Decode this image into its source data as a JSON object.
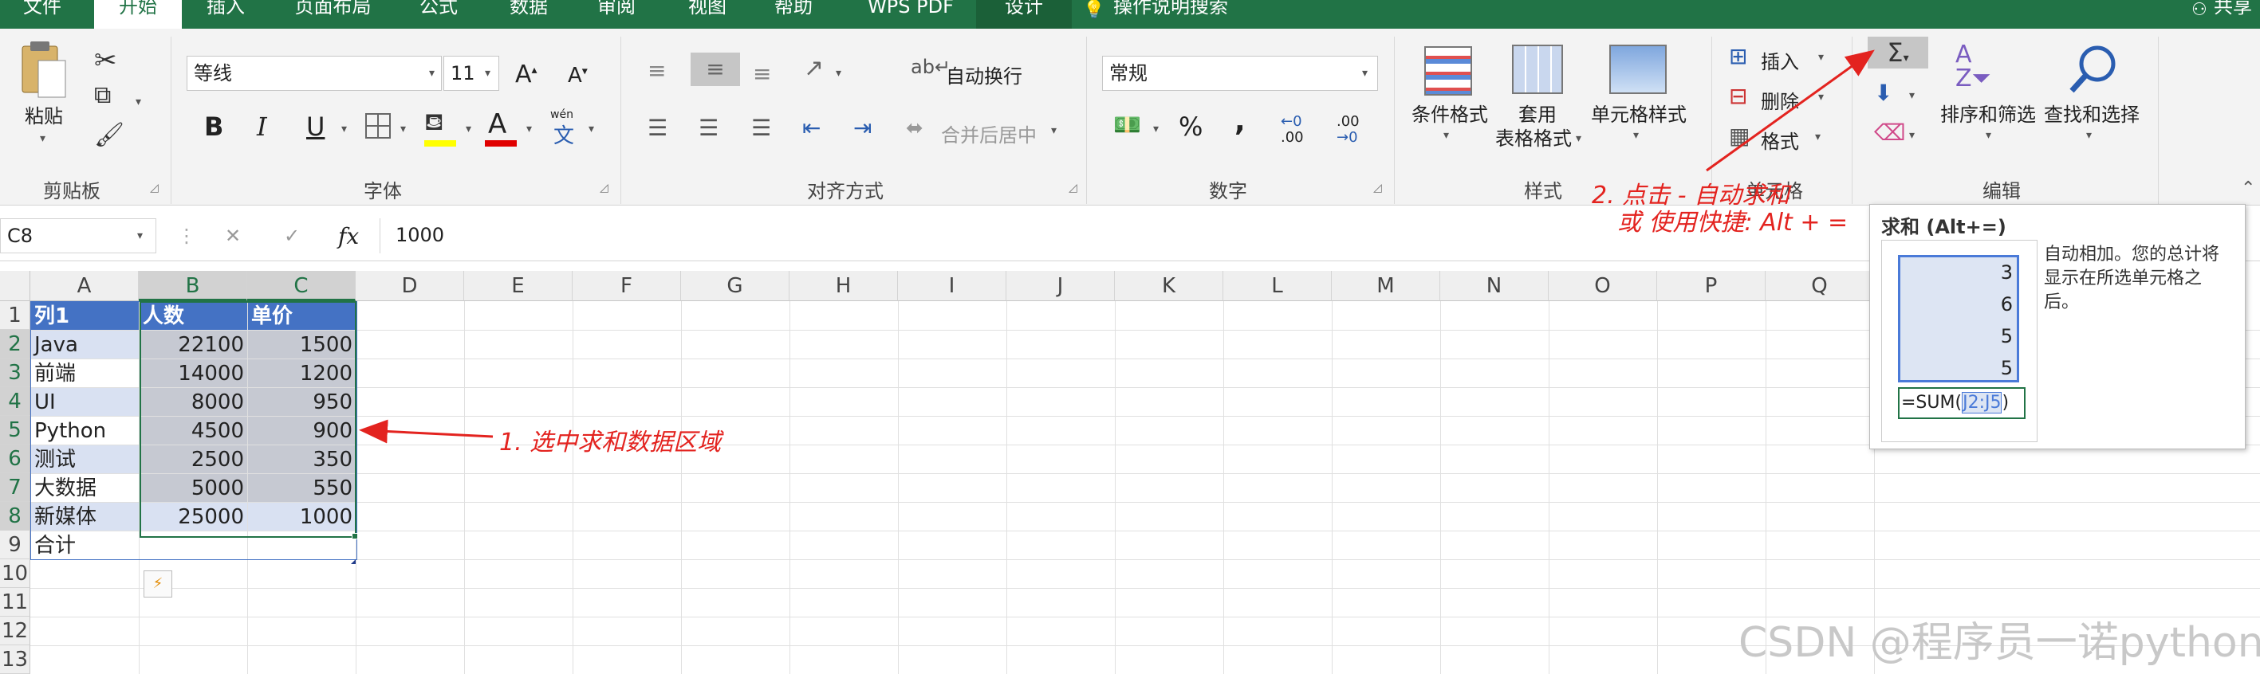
{
  "menu_tabs": [
    "文件",
    "开始",
    "插入",
    "页面布局",
    "公式",
    "数据",
    "审阅",
    "视图",
    "帮助",
    "WPS PDF",
    "设计"
  ],
  "tell_me": "操作说明搜索",
  "share": "共享",
  "clipboard": {
    "paste": "粘贴",
    "label": "剪贴板"
  },
  "font": {
    "name": "等线",
    "size": "11",
    "label": "字体",
    "bold": "B",
    "italic": "I",
    "underline": "U",
    "grow": "A",
    "shrink": "A",
    "phonetic_top": "wén",
    "phonetic_bottom": "文",
    "font_color_glyph": "A",
    "font_color": "#e00000",
    "highlight_color": "#ffff00"
  },
  "alignment": {
    "wrap": "自动换行",
    "merge": "合并后居中",
    "label": "对齐方式"
  },
  "number": {
    "format": "常规",
    "label": "数字",
    "percent": "%",
    "comma": ",",
    "inc_dec_top": "←0",
    "inc_dec_bottom": ".00",
    "dec_dec_top": ".00",
    "dec_dec_bottom": "→0"
  },
  "styles": {
    "conditional": "条件格式",
    "table_top": "套用",
    "table_bottom": "表格格式",
    "cell_styles": "单元格样式",
    "label": "样式"
  },
  "cells": {
    "insert": "插入",
    "delete": "删除",
    "format": "格式",
    "label": "单元格"
  },
  "editing": {
    "sort_filter": "排序和筛选",
    "find_select": "查找和选择",
    "label": "编辑"
  },
  "formula_bar": {
    "name_box": "C8",
    "cancel": "✕",
    "enter": "✓",
    "fx": "fx",
    "value": "1000"
  },
  "columns": [
    "A",
    "B",
    "C",
    "D",
    "E",
    "F",
    "G",
    "H",
    "I",
    "J",
    "K",
    "L",
    "M",
    "N",
    "O",
    "P",
    "Q"
  ],
  "rows": [
    "1",
    "2",
    "3",
    "4",
    "5",
    "6",
    "7",
    "8",
    "9",
    "10",
    "11",
    "12",
    "13"
  ],
  "table": {
    "headers": [
      "列1",
      "人数",
      "单价"
    ],
    "data": [
      [
        "Java",
        "22100",
        "1500"
      ],
      [
        "前端",
        "14000",
        "1200"
      ],
      [
        "UI",
        "8000",
        "950"
      ],
      [
        "Python",
        "4500",
        "900"
      ],
      [
        "测试",
        "2500",
        "350"
      ],
      [
        "大数据",
        "5000",
        "550"
      ],
      [
        "新媒体",
        "25000",
        "1000"
      ]
    ],
    "total_label": "合计"
  },
  "annotations": {
    "step1": "1. 选中求和数据区域",
    "step2_line1": "2. 点击 - 自动求和",
    "step2_line2": "或 使用快捷: Alt + ="
  },
  "tooltip": {
    "title": "求和 (Alt+=)",
    "desc_line1": "自动相加。您的总计将",
    "desc_line2": "显示在所选单元格之",
    "desc_line3": "后。",
    "values": [
      "3",
      "6",
      "5",
      "5"
    ],
    "formula_prefix": "=SUM(",
    "formula_range": "J2:J5",
    "formula_suffix": ")"
  },
  "autosum_symbol": "Σ",
  "watermark": "CSDN @程序员一诺python",
  "colors": {
    "excel_green": "#217346",
    "table_header": "#4472c4",
    "band_light": "#d9e1f2",
    "selected_fill": "#c6c9d2",
    "red": "#e3231f"
  }
}
